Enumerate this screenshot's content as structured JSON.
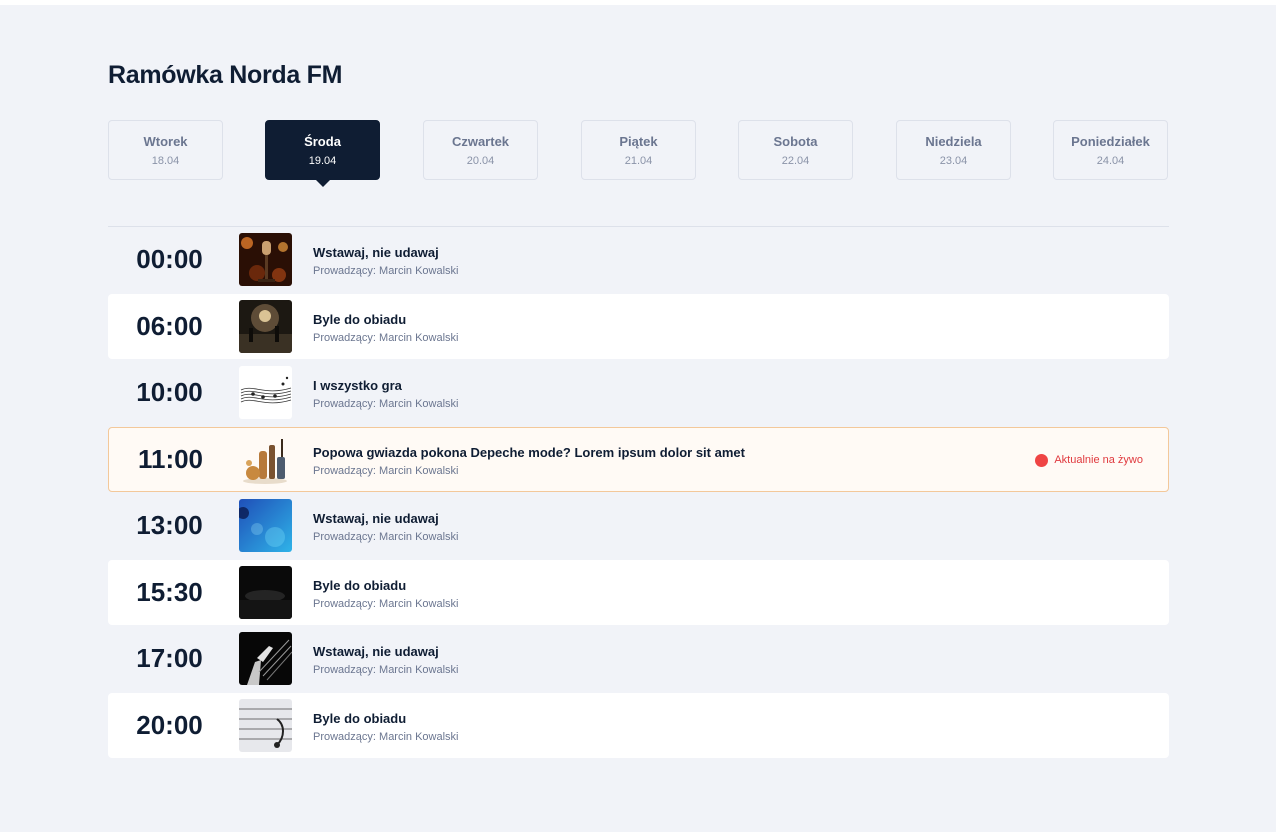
{
  "page": {
    "title": "Ramówka Norda FM"
  },
  "days": [
    {
      "name": "Wtorek",
      "date": "18.04",
      "active": false
    },
    {
      "name": "Środa",
      "date": "19.04",
      "active": true
    },
    {
      "name": "Czwartek",
      "date": "20.04",
      "active": false
    },
    {
      "name": "Piątek",
      "date": "21.04",
      "active": false
    },
    {
      "name": "Sobota",
      "date": "22.04",
      "active": false
    },
    {
      "name": "Niedziela",
      "date": "23.04",
      "active": false
    },
    {
      "name": "Poniedziałek",
      "date": "24.04",
      "active": false
    }
  ],
  "schedule": [
    {
      "time": "00:00",
      "title": "Wstawaj, nie udawaj",
      "host": "Prowadzący: Marcin Kowalski",
      "thumb": "microphone-stage-image"
    },
    {
      "time": "06:00",
      "title": "Byle do obiadu",
      "host": "Prowadzący: Marcin Kowalski",
      "thumb": "concert-stage-image"
    },
    {
      "time": "10:00",
      "title": "I wszystko gra",
      "host": "Prowadzący: Marcin Kowalski",
      "thumb": "music-notes-image"
    },
    {
      "time": "11:00",
      "title": "Popowa gwiazda pokona Depeche mode? Lorem ipsum dolor sit amet",
      "host": "Prowadzący: Marcin Kowalski",
      "thumb": "instruments-image",
      "live": true
    },
    {
      "time": "13:00",
      "title": "Wstawaj, nie udawaj",
      "host": "Prowadzący: Marcin Kowalski",
      "thumb": "blue-bokeh-image"
    },
    {
      "time": "15:30",
      "title": "Byle do obiadu",
      "host": "Prowadzący: Marcin Kowalski",
      "thumb": "dark-stage-image"
    },
    {
      "time": "17:00",
      "title": "Wstawaj, nie udawaj",
      "host": "Prowadzący: Marcin Kowalski",
      "thumb": "guitar-hand-image"
    },
    {
      "time": "20:00",
      "title": "Byle do obiadu",
      "host": "Prowadzący: Marcin Kowalski",
      "thumb": "headphones-lines-image"
    }
  ],
  "live_label": "Aktualnie na żywo",
  "colors": {
    "background": "#f1f3f8",
    "navy": "#0f1d33",
    "live_red": "#ef4444",
    "live_border": "#f3c89a"
  }
}
